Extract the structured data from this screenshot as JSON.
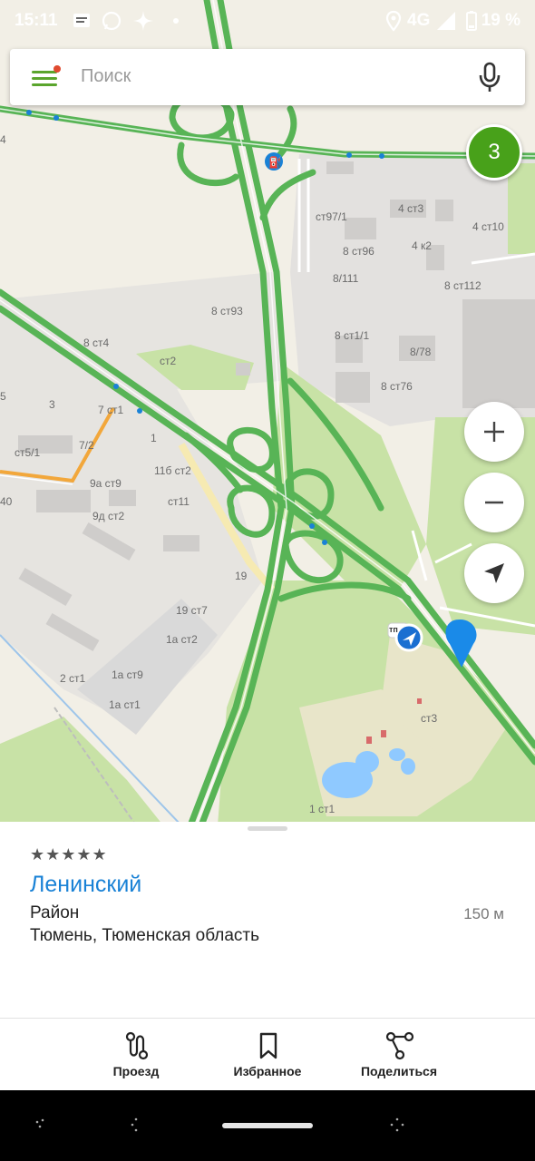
{
  "status_bar": {
    "time": "15:11",
    "network": "4G",
    "battery_percent": "19 %"
  },
  "search": {
    "placeholder": "Поиск"
  },
  "badge": {
    "count": "3"
  },
  "map_labels": [
    "ст97/1",
    "4 ст3",
    "4 ст10",
    "8 ст96",
    "4 к2",
    "8/111",
    "8 ст112",
    "8 ст93",
    "8 ст1/1",
    "8 ст4",
    "8/78",
    "ст2",
    "8 ст76",
    "3",
    "7 ст1",
    "5",
    "ст5/1",
    "7/2",
    "1",
    "11б ст2",
    "9а ст9",
    "ст11",
    "40",
    "9д ст2",
    "19",
    "19 ст7",
    "1а ст2",
    "2 ст1",
    "1а ст9",
    "1а ст1",
    "ст3",
    "1 ст1",
    "4",
    "тп"
  ],
  "place": {
    "rating_stars": "★★★★★",
    "name": "Ленинский",
    "type": "Район",
    "address": "Тюмень, Тюменская область",
    "distance": "150 м"
  },
  "actions": [
    {
      "label": "Проезд",
      "icon": "route-icon"
    },
    {
      "label": "Избранное",
      "icon": "bookmark-icon"
    },
    {
      "label": "Поделиться",
      "icon": "share-icon"
    }
  ],
  "colors": {
    "brand_green": "#48a11a",
    "road_green": "#5cb85c",
    "link_blue": "#1a82d6",
    "map_bg": "#f2efe6",
    "park": "#c8e2a6"
  }
}
